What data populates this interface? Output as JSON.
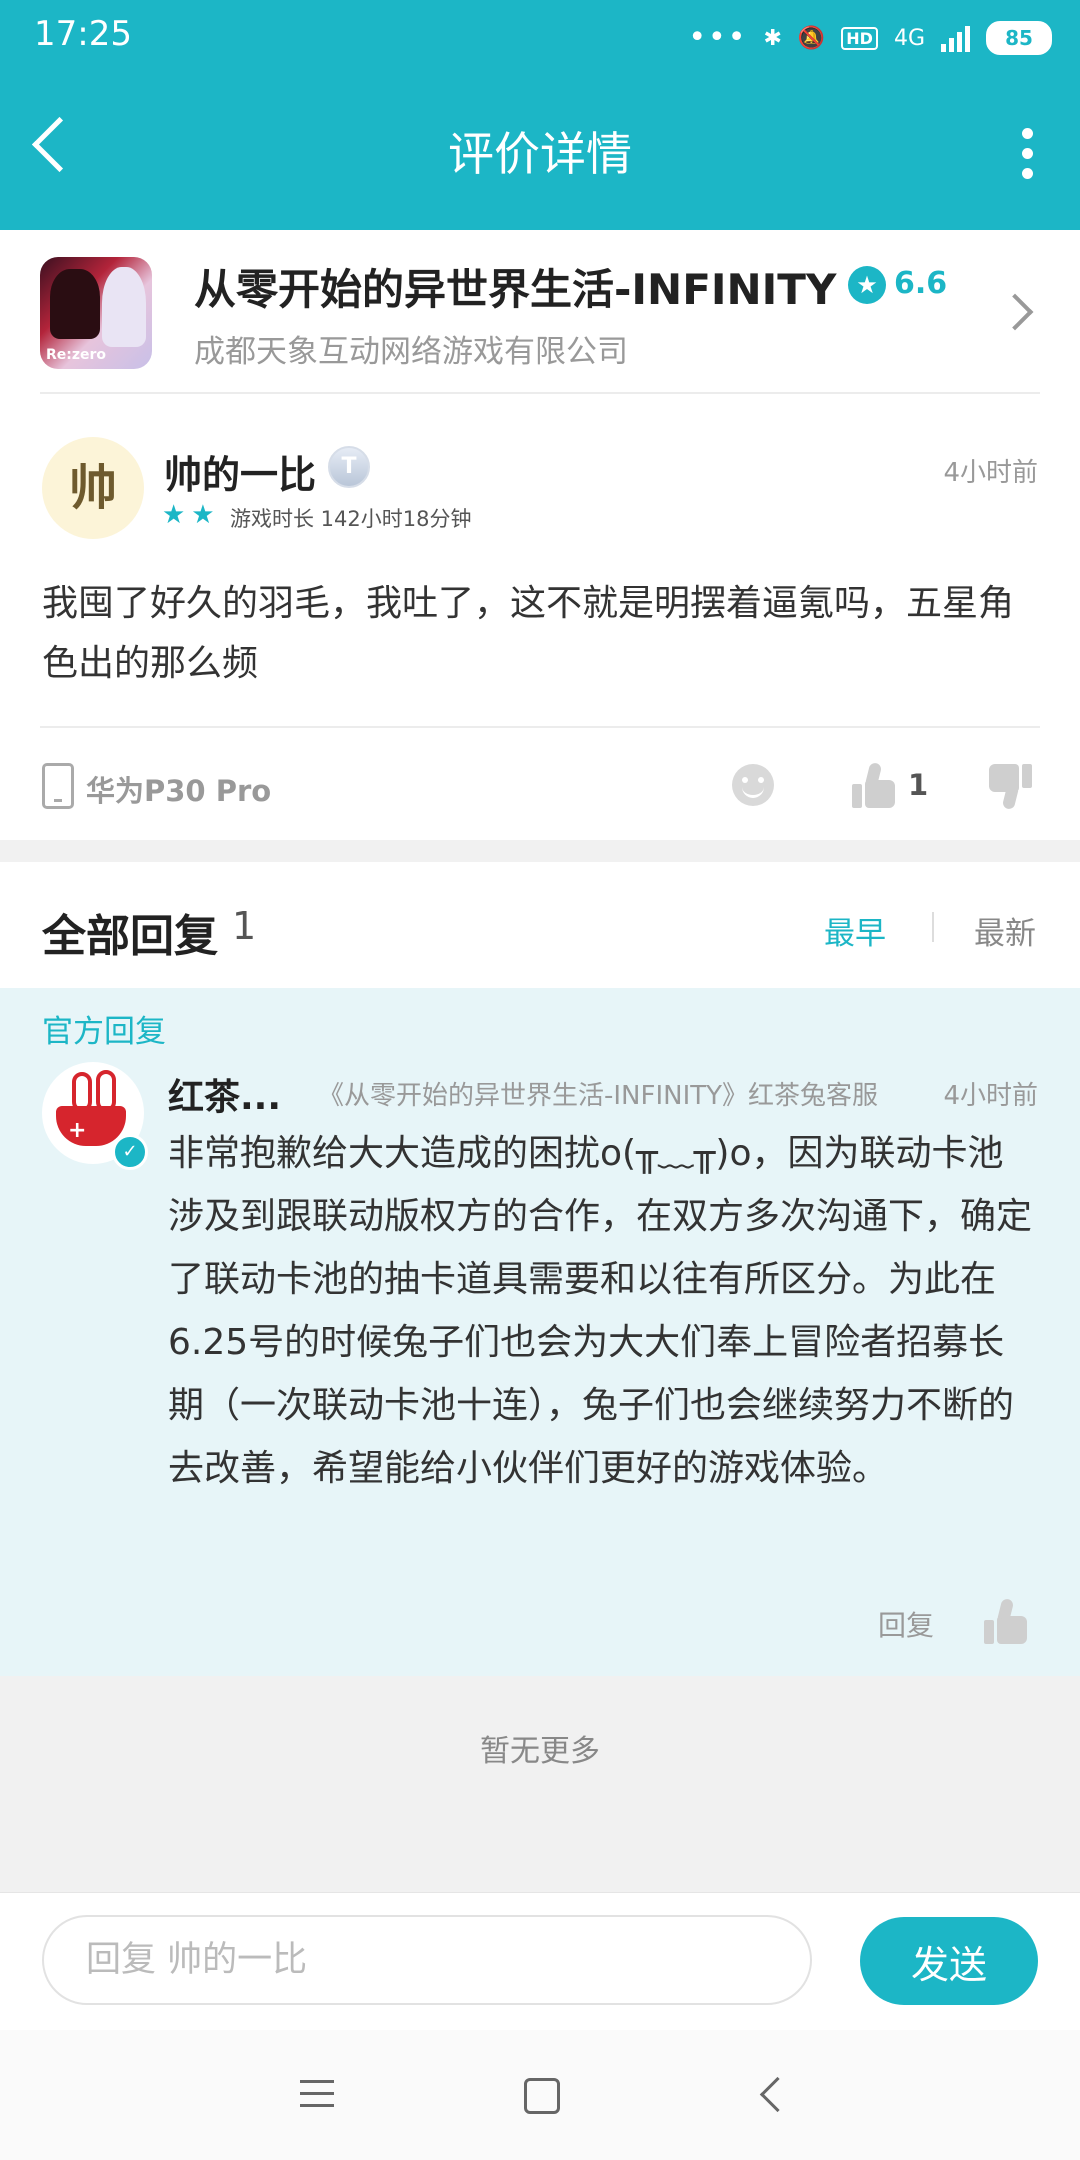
{
  "status_bar": {
    "time": "17:25",
    "dots": "•••",
    "bluetooth": "✱",
    "mute": "🔕",
    "hd": "HD",
    "network": "4G",
    "battery": "85"
  },
  "header": {
    "title": "评价详情"
  },
  "game": {
    "name": "从零开始的异世界生活-INFINITY",
    "icon_text": "Re:zero",
    "score": "6.6",
    "company": "成都天象互动网络游戏有限公司"
  },
  "review": {
    "avatar_char": "帅",
    "user_name": "帅的一比",
    "level": "T",
    "stars": "★★",
    "play_time": "游戏时长 142小时18分钟",
    "time": "4小时前",
    "text": "我囤了好久的羽毛，我吐了，这不就是明摆着逼氪吗，五星角色出的那么频",
    "device": "华为P30 Pro",
    "likes": "1"
  },
  "replies": {
    "title": "全部回复",
    "count": "1",
    "sort_earliest": "最早",
    "sort_newest": "最新",
    "official_label": "官方回复",
    "items": [
      {
        "name": "红茶...",
        "role": "《从零开始的异世界生活-INFINITY》红茶兔客服",
        "time": "4小时前",
        "text": "非常抱歉给大大造成的困扰o(╥﹏╥)o，因为联动卡池涉及到跟联动版权方的合作，在双方多次沟通下，确定了联动卡池的抽卡道具需要和以往有所区分。为此在6.25号的时候兔子们也会为大大们奉上冒险者招募长期（一次联动卡池十连），兔子们也会继续努力不断的去改善，希望能给小伙伴们更好的游戏体验。",
        "reply_label": "回复"
      }
    ],
    "no_more": "暂无更多"
  },
  "compose": {
    "placeholder": "回复 帅的一比",
    "send_label": "发送"
  },
  "colors": {
    "accent": "#1cb6c6",
    "official_bg": "#e7f5f8"
  }
}
